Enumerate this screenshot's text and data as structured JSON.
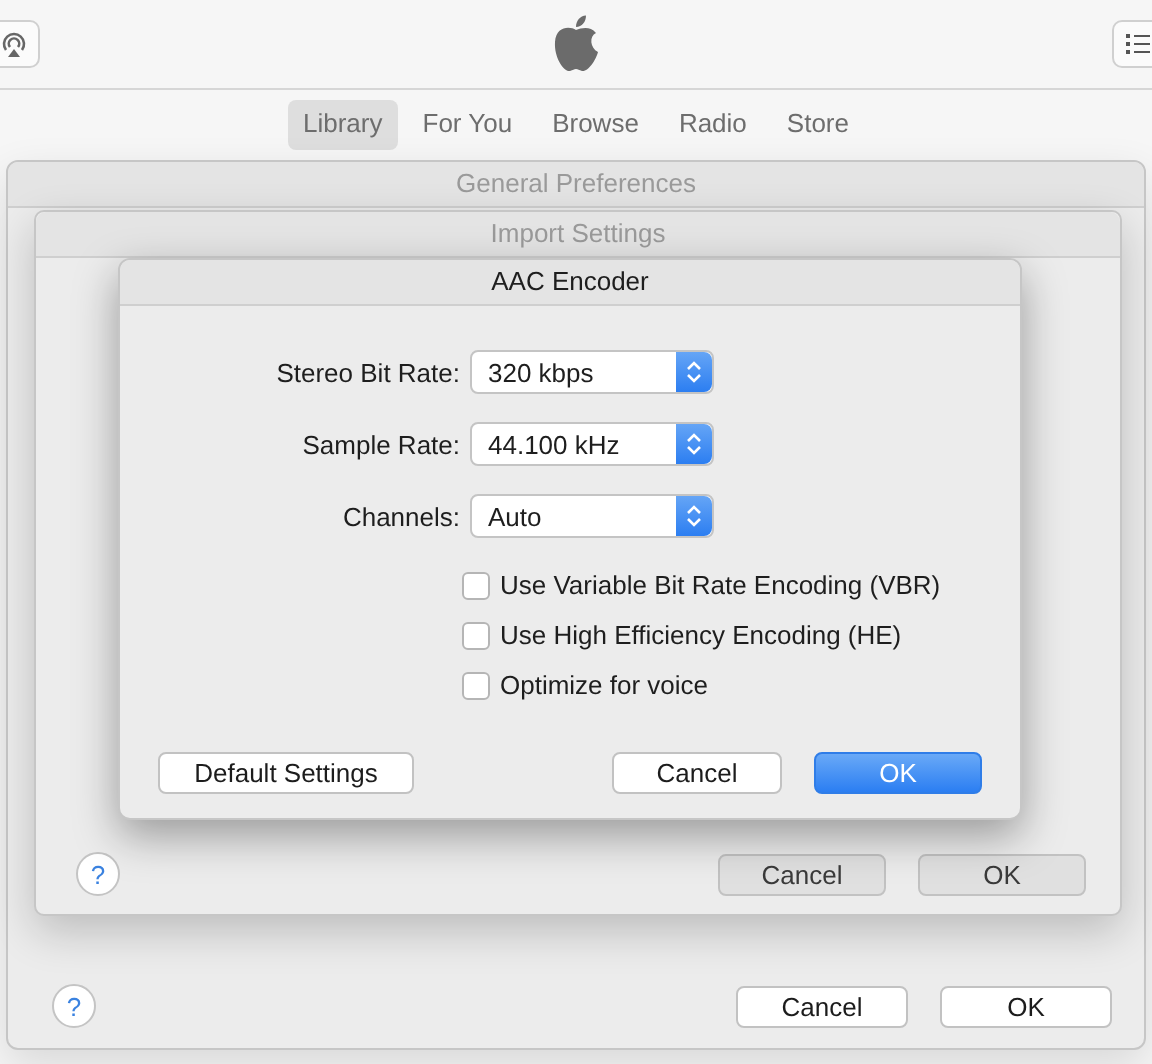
{
  "nav_tabs": [
    {
      "label": "Library",
      "selected": true
    },
    {
      "label": "For You",
      "selected": false
    },
    {
      "label": "Browse",
      "selected": false
    },
    {
      "label": "Radio",
      "selected": false
    },
    {
      "label": "Store",
      "selected": false
    }
  ],
  "general_preferences": {
    "title": "General Preferences",
    "help": "?",
    "buttons": [
      {
        "label": "Cancel",
        "default": false
      },
      {
        "label": "OK",
        "default": false
      }
    ]
  },
  "import_settings": {
    "title": "Import Settings",
    "help": "?",
    "buttons": [
      {
        "label": "Cancel",
        "default": false
      },
      {
        "label": "OK",
        "default": false
      }
    ]
  },
  "aac_encoder": {
    "title": "AAC Encoder",
    "popups": [
      {
        "label": "Stereo Bit Rate:",
        "value": "320 kbps"
      },
      {
        "label": "Sample Rate:",
        "value": "44.100 kHz"
      },
      {
        "label": "Channels:",
        "value": "Auto"
      }
    ],
    "options": [
      {
        "label": "Use Variable Bit Rate Encoding (VBR)",
        "checked": false
      },
      {
        "label": "Use High Efficiency Encoding (HE)",
        "checked": false
      },
      {
        "label": "Optimize for voice",
        "checked": false
      }
    ],
    "left_button": {
      "label": "Default Settings"
    },
    "buttons": [
      {
        "label": "Cancel",
        "default": false
      },
      {
        "label": "OK",
        "default": true
      }
    ]
  }
}
